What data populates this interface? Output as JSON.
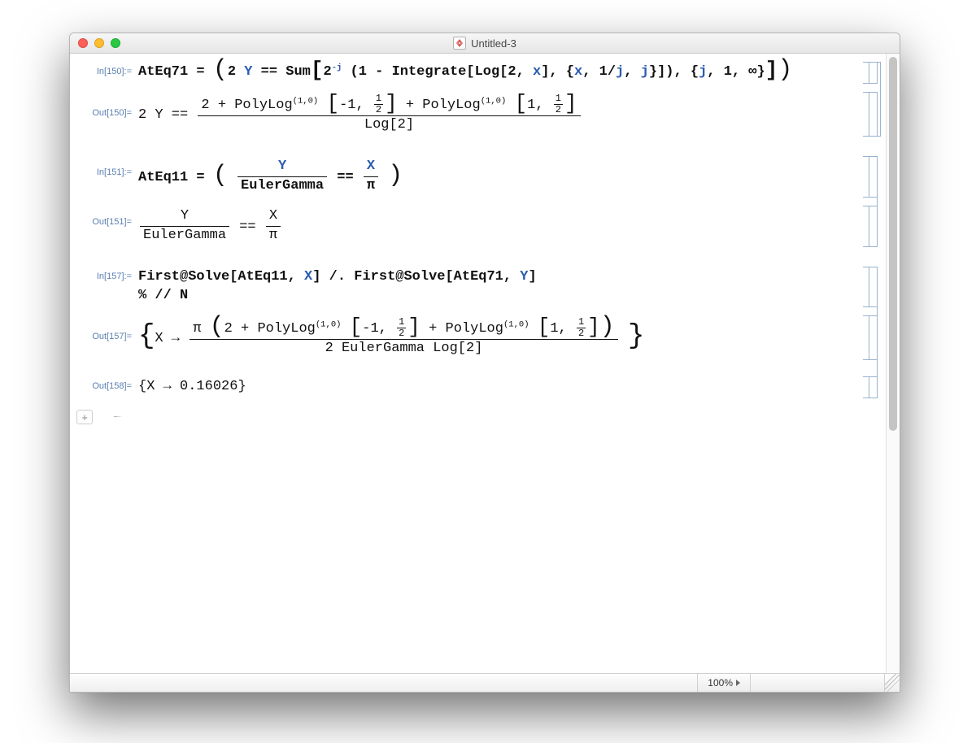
{
  "window": {
    "title": "Untitled-3"
  },
  "statusbar": {
    "zoom": "100%"
  },
  "cells": {
    "in150": {
      "label": "In[150]:=",
      "lhs": "AtEq71",
      "eq": " = ",
      "p_open": "(",
      "two": "2",
      "Y": "Y",
      "deq": " == ",
      "Sum": "Sum",
      "lb": "[",
      "base": "2",
      "exp_neg": "-",
      "exp_j": "j",
      "sp_open": " (",
      "one": "1",
      "minus": " - ",
      "Integrate": "Integrate",
      "lb2": "[",
      "Log": "Log",
      "lb3": "[",
      "logbase": "2",
      "comma": ", ",
      "x": "x",
      "rb3": "]",
      "comma2": ", ",
      "brace_o": "{",
      "x2": "x",
      "comma3": ", ",
      "oneoverj_1": "1",
      "slash": "/",
      "oneoverj_j": "j",
      "comma4": ", ",
      "j2": "j",
      "brace_c": "}",
      "rb2": "]",
      "sp_close": ")",
      "comma5": ", ",
      "brace_o2": "{",
      "j3": "j",
      "comma6": ", ",
      "one2": "1",
      "comma7": ", ",
      "inf": "∞",
      "brace_c2": "}",
      "rb": "]",
      "p_close": ")"
    },
    "out150": {
      "label": "Out[150]=",
      "pre": "2 Y == ",
      "num_a": "2 + PolyLog",
      "sup1": "(1,0)",
      "br_o1": "[",
      "neg1": "-1, ",
      "half_n": "1",
      "half_d": "2",
      "br_c1": "]",
      "plus": " + PolyLog",
      "sup2": "(1,0)",
      "br_o2": "[",
      "one_arg": "1, ",
      "half2_n": "1",
      "half2_d": "2",
      "br_c2": "]",
      "den": "Log[2]"
    },
    "in151": {
      "label": "In[151]:=",
      "lhs": "AtEq11",
      "eq": " = ",
      "Y": "Y",
      "EG": "EulerGamma",
      "deq": " == ",
      "X": "X",
      "pi": "π"
    },
    "out151": {
      "label": "Out[151]=",
      "Y": "Y",
      "EG": "EulerGamma",
      "deq": " == ",
      "X": "X",
      "pi": "π"
    },
    "in157": {
      "label": "In[157]:=",
      "line1_a": "First@Solve[AtEq11, ",
      "X": "X",
      "line1_b": "] /. First@Solve[AtEq71, ",
      "Y": "Y",
      "line1_c": "]",
      "line2": "% // N"
    },
    "out157": {
      "label": "Out[157]=",
      "X": "X",
      "arrow": " → ",
      "num_pi": "π ",
      "num_open": "(",
      "num_a": "2 + PolyLog",
      "sup1": "(1,0)",
      "br_o1": "[",
      "neg1": "-1, ",
      "half_n": "1",
      "half_d": "2",
      "br_c1": "]",
      "plus": " + PolyLog",
      "sup2": "(1,0)",
      "br_o2": "[",
      "one_arg": "1, ",
      "half2_n": "1",
      "half2_d": "2",
      "br_c2": "]",
      "num_close": ")",
      "den": "2 EulerGamma Log[2]"
    },
    "out158": {
      "label": "Out[158]=",
      "text_a": "{X → ",
      "val": "0.16026",
      "text_b": "}"
    }
  }
}
